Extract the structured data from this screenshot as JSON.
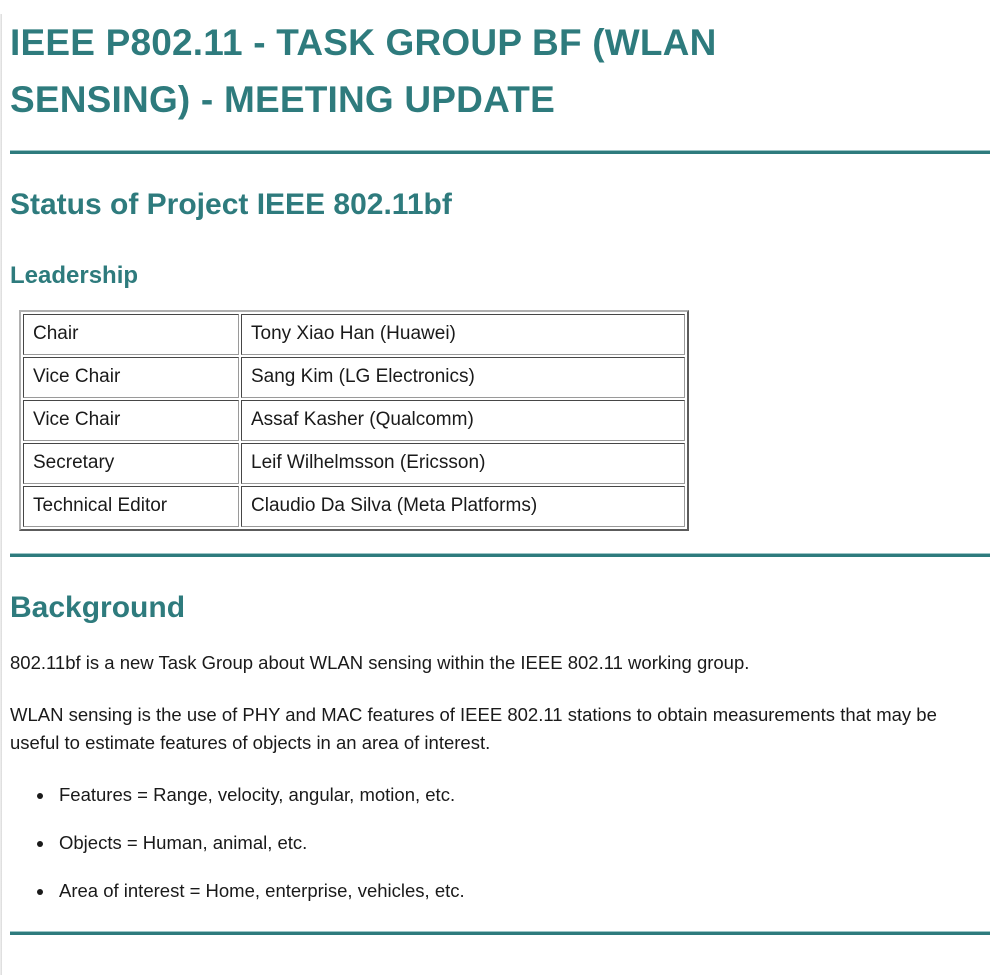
{
  "document": {
    "title": "IEEE P802.11 - Task Group BF (WLAN Sensing) - Meeting Update",
    "accent_color": "#2e7b7d",
    "text_color": "#1a1a1a",
    "background_color": "#ffffff"
  },
  "sections": {
    "status": {
      "heading": "Status of Project IEEE 802.11bf",
      "leadership": {
        "heading": "Leadership",
        "rows": [
          {
            "role": "Chair",
            "person": "Tony Xiao Han (Huawei)"
          },
          {
            "role": "Vice Chair",
            "person": "Sang Kim (LG Electronics)"
          },
          {
            "role": "Vice Chair",
            "person": "Assaf Kasher (Qualcomm)"
          },
          {
            "role": "Secretary",
            "person": "Leif Wilhelmsson (Ericsson)"
          },
          {
            "role": "Technical Editor",
            "person": "Claudio Da Silva (Meta Platforms)"
          }
        ]
      }
    },
    "background": {
      "heading": "Background",
      "paragraphs": [
        "802.11bf is a new Task Group about WLAN sensing within the IEEE 802.11 working group.",
        "WLAN sensing is the use of PHY and MAC features of IEEE 802.11 stations to obtain measurements that may be useful to estimate features of objects in an area of interest."
      ],
      "bullets": [
        "Features = Range, velocity, angular, motion, etc.",
        "Objects = Human, animal, etc.",
        "Area of interest = Home, enterprise, vehicles, etc."
      ]
    }
  }
}
